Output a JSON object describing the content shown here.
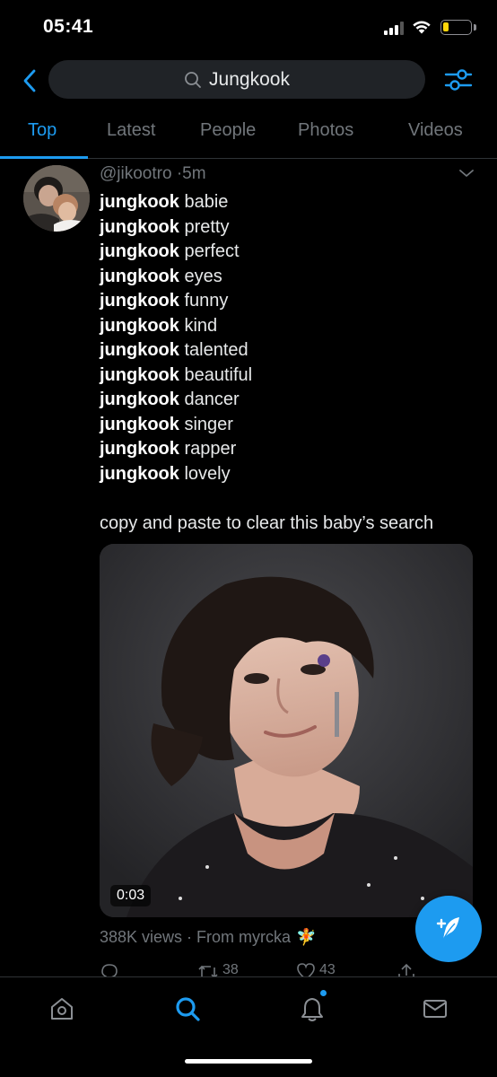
{
  "status_bar": {
    "time": "05:41",
    "signal_icon": "cellular-signal-icon",
    "wifi_icon": "wifi-icon",
    "battery_icon": "battery-low-icon",
    "battery_level": 0.2,
    "battery_color": "#ffd60a"
  },
  "header": {
    "back_icon": "chevron-left-icon",
    "search_icon": "search-icon",
    "search_value": "Jungkook",
    "filter_icon": "sliders-icon"
  },
  "tabs": [
    {
      "label": "Top",
      "active": true
    },
    {
      "label": "Latest",
      "active": false
    },
    {
      "label": "People",
      "active": false
    },
    {
      "label": "Photos",
      "active": false
    },
    {
      "label": "Videos",
      "active": false
    }
  ],
  "tweet": {
    "handle": "@jikootro",
    "separator": "·",
    "time": "5m",
    "lines": [
      {
        "keyword": "jungkook",
        "text": "babie"
      },
      {
        "keyword": "jungkook",
        "text": "pretty"
      },
      {
        "keyword": "jungkook",
        "text": "perfect"
      },
      {
        "keyword": "jungkook",
        "text": "eyes"
      },
      {
        "keyword": "jungkook",
        "text": "funny"
      },
      {
        "keyword": "jungkook",
        "text": "kind"
      },
      {
        "keyword": "jungkook",
        "text": "talented"
      },
      {
        "keyword": "jungkook",
        "text": "beautiful"
      },
      {
        "keyword": "jungkook",
        "text": "dancer"
      },
      {
        "keyword": "jungkook",
        "text": "singer"
      },
      {
        "keyword": "jungkook",
        "text": "rapper"
      },
      {
        "keyword": "jungkook",
        "text": "lovely"
      }
    ],
    "closing_text": "copy and paste to clear this baby’s search",
    "video_duration": "0:03",
    "views_text": "388K views · From myrcka",
    "views_emoji": "🧚",
    "actions": {
      "reply_icon": "reply-icon",
      "retweet_icon": "retweet-icon",
      "retweet_count": "38",
      "like_icon": "heart-icon",
      "like_count": "43",
      "share_icon": "share-icon"
    }
  },
  "fab": {
    "icon": "compose-tweet-icon"
  },
  "bottom_nav": [
    {
      "name": "home",
      "icon": "home-icon",
      "active": false
    },
    {
      "name": "search",
      "icon": "search-icon",
      "active": true
    },
    {
      "name": "notifications",
      "icon": "bell-icon",
      "active": false,
      "has_badge": true
    },
    {
      "name": "messages",
      "icon": "mail-icon",
      "active": false
    }
  ],
  "colors": {
    "accent": "#1d9bf0",
    "background": "#000000",
    "text_primary": "#e7e9ea",
    "text_secondary": "#71767b",
    "search_bg": "#202327"
  }
}
